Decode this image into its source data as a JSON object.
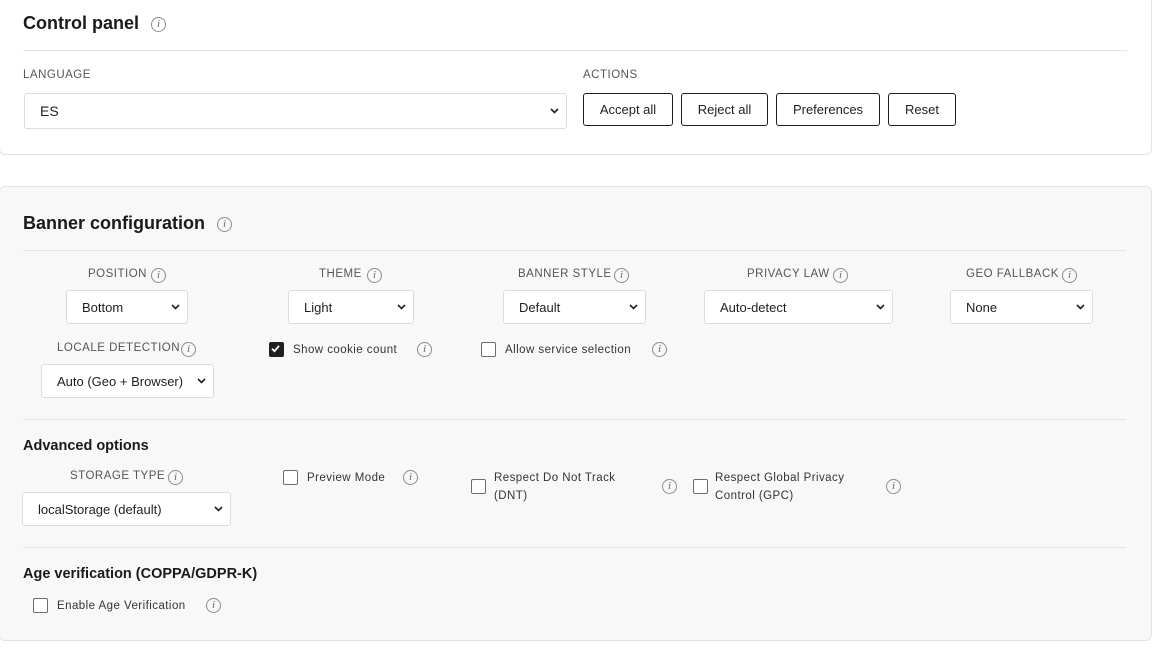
{
  "control_panel": {
    "title": "Control panel",
    "language_label": "LANGUAGE",
    "language_value": "ES",
    "actions_label": "ACTIONS",
    "actions": {
      "accept_all": "Accept all",
      "reject_all": "Reject all",
      "preferences": "Preferences",
      "reset": "Reset"
    }
  },
  "banner_config": {
    "title": "Banner configuration",
    "position": {
      "label": "POSITION",
      "value": "Bottom"
    },
    "theme": {
      "label": "THEME",
      "value": "Light"
    },
    "banner_style": {
      "label": "BANNER STYLE",
      "value": "Default"
    },
    "privacy_law": {
      "label": "PRIVACY LAW",
      "value": "Auto-detect"
    },
    "geo_fallback": {
      "label": "GEO FALLBACK",
      "value": "None"
    },
    "locale_detection": {
      "label": "LOCALE DETECTION",
      "value": "Auto (Geo + Browser)"
    },
    "show_cookie_count": {
      "label": "Show cookie count",
      "checked": true
    },
    "allow_service_selection": {
      "label": "Allow service selection",
      "checked": false
    }
  },
  "advanced": {
    "title": "Advanced options",
    "storage_type": {
      "label": "STORAGE TYPE",
      "value": "localStorage (default)"
    },
    "preview_mode": {
      "label": "Preview Mode",
      "checked": false
    },
    "dnt": {
      "line1": "Respect Do Not Track",
      "line2": "(DNT)",
      "checked": false
    },
    "gpc": {
      "line1": "Respect Global Privacy",
      "line2": "Control (GPC)",
      "checked": false
    }
  },
  "age_verification": {
    "title": "Age verification (COPPA/GDPR-K)",
    "enable": {
      "label": "Enable Age Verification",
      "checked": false
    }
  },
  "icons": {
    "info": "i"
  }
}
